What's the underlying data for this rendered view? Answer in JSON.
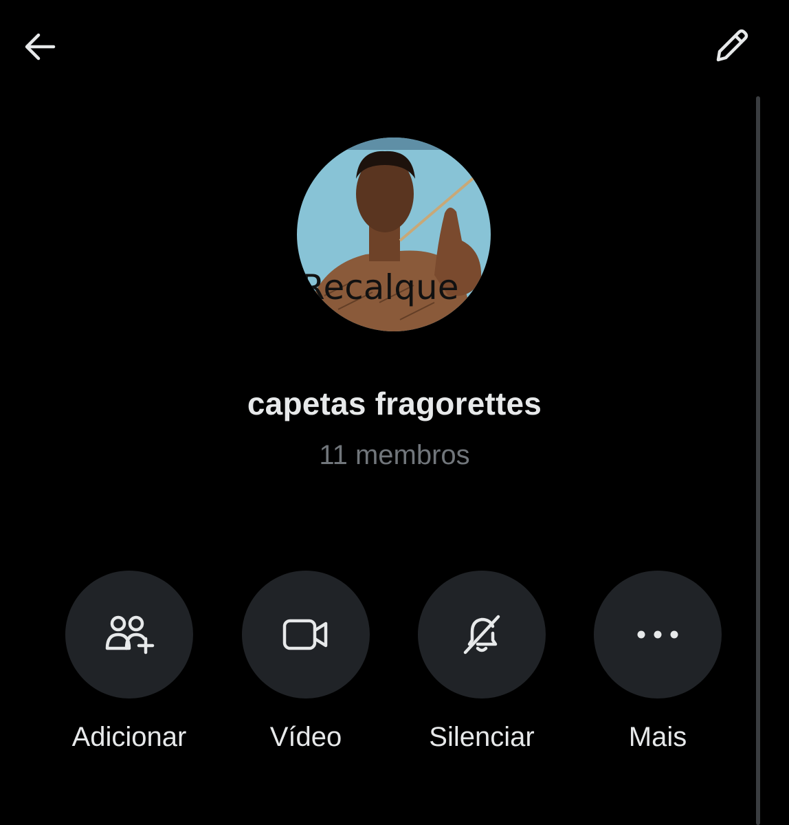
{
  "header": {
    "back_icon": "arrow-left-icon",
    "edit_icon": "pencil-icon"
  },
  "group": {
    "avatar_text": "Recalque",
    "name": "capetas fragorettes",
    "members": "11 membros"
  },
  "actions": [
    {
      "label": "Adicionar",
      "icon": "add-people-icon"
    },
    {
      "label": "Vídeo",
      "icon": "video-camera-icon"
    },
    {
      "label": "Silenciar",
      "icon": "bell-muted-icon"
    },
    {
      "label": "Mais",
      "icon": "more-dots-icon"
    }
  ],
  "colors": {
    "background": "#000000",
    "text_primary": "#e7e9ea",
    "text_secondary": "#71767b",
    "button_bg": "#202327"
  }
}
